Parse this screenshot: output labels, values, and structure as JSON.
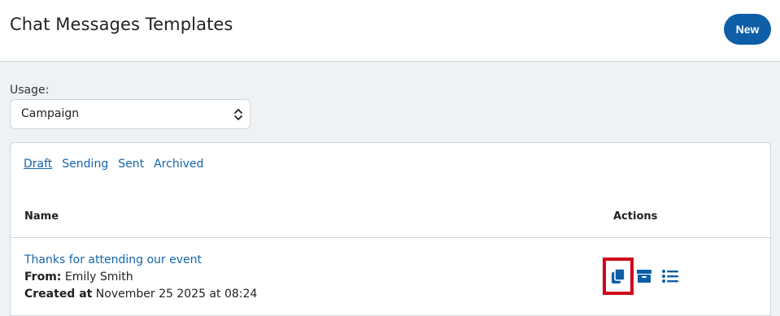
{
  "header": {
    "title": "Chat Messages Templates",
    "new_label": "New"
  },
  "usage": {
    "label": "Usage:",
    "selected": "Campaign"
  },
  "tabs": [
    {
      "label": "Draft",
      "active": true
    },
    {
      "label": "Sending",
      "active": false
    },
    {
      "label": "Sent",
      "active": false
    },
    {
      "label": "Archived",
      "active": false
    }
  ],
  "table": {
    "columns": [
      "Name",
      "Actions"
    ],
    "rows": [
      {
        "title": "Thanks for attending our event",
        "from_label": "From:",
        "from_value": "Emily Smith",
        "created_label": "Created at",
        "created_value": "November 25 2025 at 08:24",
        "actions": [
          "copy-icon",
          "archive-icon",
          "list-icon"
        ]
      }
    ]
  },
  "colors": {
    "accent": "#0e5ea8",
    "link": "#1465a8",
    "highlight": "#d0021b",
    "background": "#eef2f5"
  }
}
